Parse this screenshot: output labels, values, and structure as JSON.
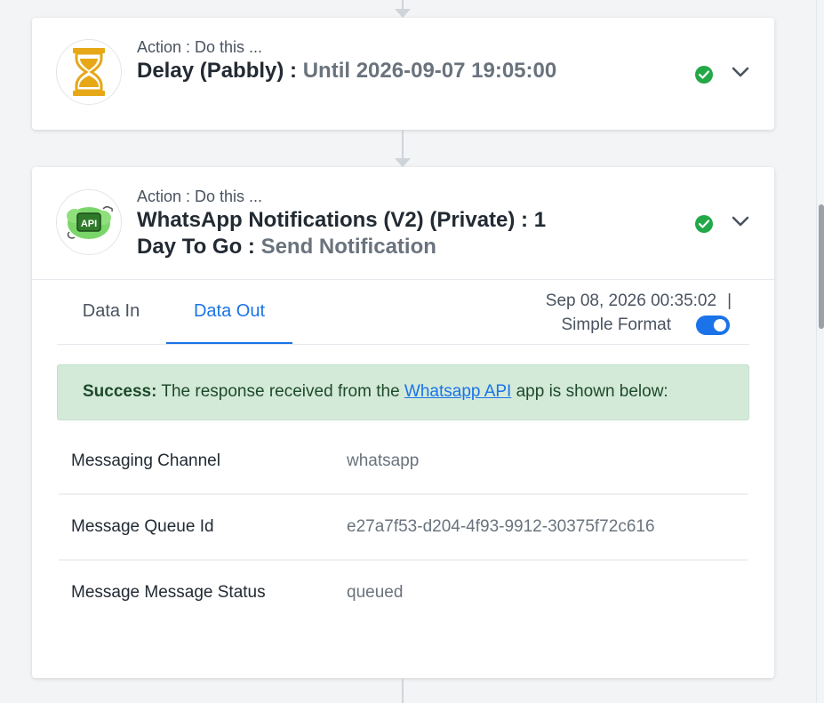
{
  "steps": [
    {
      "action_label": "Action : Do this ...",
      "title": "Delay (Pabbly) :",
      "subtitle": "Until 2026-09-07 19:05:00",
      "icon": "hourglass-icon",
      "status": "success"
    },
    {
      "action_label": "Action : Do this ...",
      "title": "WhatsApp Notifications (V2) (Private) : 1 Day To Go :",
      "subtitle": "Send Notification",
      "icon": "whatsapp-api-icon",
      "status": "success",
      "tabs": [
        {
          "label": "Data In",
          "active": false
        },
        {
          "label": "Data Out",
          "active": true
        }
      ],
      "timestamp": "Sep 08, 2026 00:35:02",
      "separator": "|",
      "simple_format_label": "Simple Format",
      "simple_format_on": true,
      "success": {
        "prefix": "Success:",
        "text_before": " The response received from the ",
        "link": "Whatsapp API",
        "text_after": " app is shown below:"
      },
      "response_rows": [
        {
          "key": "Messaging Channel",
          "value": "whatsapp"
        },
        {
          "key": "Message Queue Id",
          "value": "e27a7f53-d204-4f93-9912-30375f72c616"
        },
        {
          "key": "Message Message Status",
          "value": "queued"
        }
      ]
    }
  ],
  "api_icon_text": "API",
  "colors": {
    "accent": "#1a73e8",
    "success_check": "#23a848",
    "success_bg": "#d4ead8",
    "hourglass": "#e6a817"
  }
}
